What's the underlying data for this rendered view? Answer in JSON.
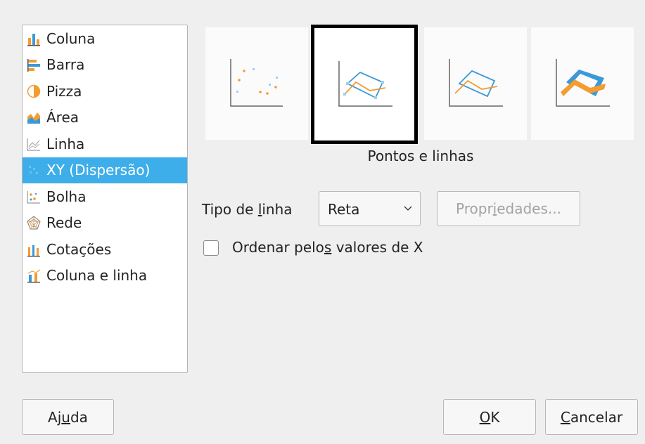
{
  "chart_types": [
    {
      "label": "Coluna",
      "icon": "column-chart-icon"
    },
    {
      "label": "Barra",
      "icon": "bar-chart-icon"
    },
    {
      "label": "Pizza",
      "icon": "pie-chart-icon"
    },
    {
      "label": "Área",
      "icon": "area-chart-icon"
    },
    {
      "label": "Linha",
      "icon": "line-chart-icon"
    },
    {
      "label": "XY (Dispersão)",
      "icon": "scatter-chart-icon",
      "selected": true
    },
    {
      "label": "Bolha",
      "icon": "bubble-chart-icon"
    },
    {
      "label": "Rede",
      "icon": "net-chart-icon"
    },
    {
      "label": "Cotações",
      "icon": "stock-chart-icon"
    },
    {
      "label": "Coluna e linha",
      "icon": "column-line-chart-icon"
    }
  ],
  "variants": [
    {
      "name": "points-only",
      "icon": "scatter-points-icon"
    },
    {
      "name": "points-and-lines",
      "icon": "scatter-points-lines-icon",
      "selected": true
    },
    {
      "name": "lines-only",
      "icon": "scatter-lines-icon"
    },
    {
      "name": "3d-lines",
      "icon": "scatter-3d-lines-icon"
    }
  ],
  "variant_label": "Pontos e linhas",
  "line_type": {
    "label_pre": "Tipo de ",
    "label_mn": "l",
    "label_post": "inha",
    "value": "Reta"
  },
  "properties_button": {
    "pre": "Propr",
    "mn": "i",
    "post": "edades..."
  },
  "sort_checkbox": {
    "pre": "Ordenar pelo",
    "mn": "s",
    "post": " valores de X",
    "checked": false
  },
  "help_button": {
    "pre": "Aj",
    "mn": "u",
    "post": "da"
  },
  "ok_button": {
    "pre": "",
    "mn": "O",
    "post": "K"
  },
  "cancel_button": {
    "pre": "",
    "mn": "C",
    "post": "ancelar"
  },
  "colors": {
    "selection": "#3daee9",
    "series_blue": "#3a9ad9",
    "series_orange": "#f39c30"
  }
}
